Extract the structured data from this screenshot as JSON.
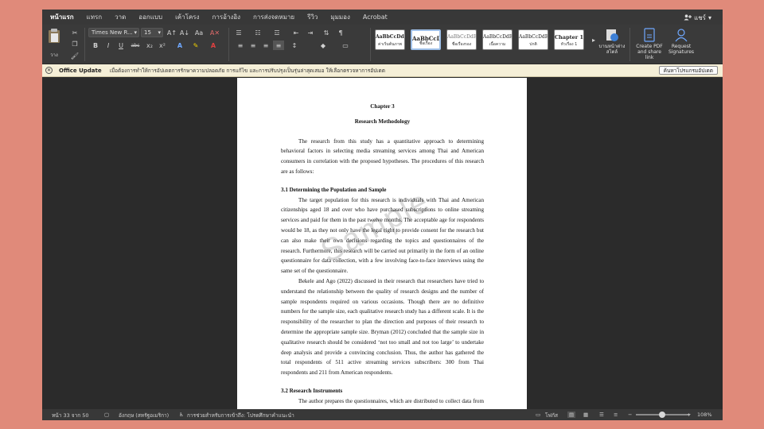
{
  "tabs": [
    "หน้าแรก",
    "แทรก",
    "วาด",
    "ออกแบบ",
    "เค้าโครง",
    "การอ้างอิง",
    "การส่งจดหมาย",
    "รีวิว",
    "มุมมอง",
    "Acrobat"
  ],
  "share_label": "แชร์",
  "ribbon": {
    "paste_label": "วาง",
    "font_name": "Times New R...",
    "font_size": "15",
    "styles": [
      {
        "sample": "AaBbCcDdEe",
        "name": "ค่าเริ่มต้น​ภาพ"
      },
      {
        "sample": "AaBbCcDdI",
        "name": "ชื่อเรื่อง"
      },
      {
        "sample": "AaBbCcDdEe",
        "name": "ชื่อเรื่องรอง"
      },
      {
        "sample": "AaBbCcDdEe",
        "name": "เนื้อความ"
      },
      {
        "sample": "AaBbCcDdEe",
        "name": "ปกติ"
      },
      {
        "sample": "Chapter 1",
        "name": "หัวเรื่อง 1"
      }
    ],
    "styles_pane_label": "บานหน้าต่างสไตล์",
    "create_pdf_label": "Create PDF and share link",
    "request_signatures_label": "Request Signatures"
  },
  "message_bar": {
    "title": "Office Update",
    "text": "เมื่อต้องการทำให้การอัปเดตการรักษาความปลอดภัย การแก้ไข และการปรับปรุงเป็นรุ่นล่าสุดเสมอ ให้เลือกตรวจหาการอัปเดต",
    "button": "ค้นหาโปรแกรมอัปเดต"
  },
  "document": {
    "chapter": "Chapter 3",
    "chapter_title": "Research Methodology",
    "intro": "The research from this study has a quantitative approach to determining behavioral factors in selecting media streaming services among Thai and American consumers in correlation with the proposed hypotheses. The procedures of this research are as follows:",
    "section1_heading": "3.1 Determining the Population and Sample",
    "section1_p1": "The target population for this research is individuals with Thai and American citizenships aged 18 and over who have purchased subscriptions to online streaming services and paid for them in the past twelve months. The acceptable age for respondents would be 18, as they not only have the legal right to provide consent for the research but can also make their own decisions regarding the topics and questionnaires of the research. Furthermore, this research will be carried out primarily in the form of an online questionnaire for data collection, with a few involving face-to-face interviews using the same set of the questionnaire.",
    "section1_p2": "Bekele and Ago (2022) discussed in their research that researchers have tried to understand the relationship between the quality of research designs and the number of sample respondents required on various occasions. Though there are no definitive numbers for the sample size, each qualitative research study has a different scale. It is the responsibility of the researcher to plan the direction and purposes of their research to determine the appropriate sample size. Bryman (2012) concluded that the sample size in qualitative research should be considered ‘not too small and not too large’ to undertake deep analysis and provide a convincing conclusion. Thus, the author has gathered the total respondents of 511 active streaming services subscribers: 300 from Thai respondents and 211 from American respondents.",
    "section2_heading": "3.2 Research Instruments",
    "section2_p1": "The author prepares the questionnaires, which are distributed to collect data from the respondents. Kuphanga (2024) referred to the advantage of questionnaires as the instrument that enables contact with large and dispersed populations at a relatively",
    "watermark": "Sample"
  },
  "status_bar": {
    "page": "หน้า 33 จาก 50",
    "language": "อังกฤษ (สหรัฐอเมริกา)",
    "accessibility": "การช่วยสำหรับการเข้าถึง: โปรดศึกษาคำแนะนำ",
    "focus": "โฟกัส",
    "zoom": "108%"
  }
}
